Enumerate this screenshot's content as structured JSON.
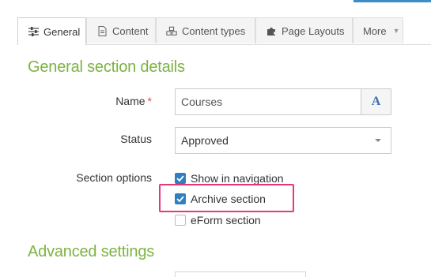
{
  "tabs": [
    {
      "label": "General",
      "icon": "sliders-icon",
      "active": true
    },
    {
      "label": "Content",
      "icon": "document-icon"
    },
    {
      "label": "Content types",
      "icon": "cubes-icon"
    },
    {
      "label": "Page Layouts",
      "icon": "puzzle-icon"
    },
    {
      "label": "More",
      "icon": "caret-down-icon"
    }
  ],
  "general": {
    "heading": "General section details",
    "name_label": "Name",
    "required_mark": "*",
    "name_value": "Courses",
    "format_button": "A",
    "status_label": "Status",
    "status_value": "Approved",
    "options_label": "Section options",
    "options": [
      {
        "label": "Show in navigation",
        "checked": true
      },
      {
        "label": "Archive section",
        "checked": true,
        "highlighted": true
      },
      {
        "label": "eForm section",
        "checked": false
      }
    ]
  },
  "advanced": {
    "heading": "Advanced settings"
  },
  "colors": {
    "heading_green": "#7cb342",
    "checkbox_blue": "#2f7fc1",
    "highlight_pink": "#e8367a",
    "required_red": "#d9534f"
  }
}
